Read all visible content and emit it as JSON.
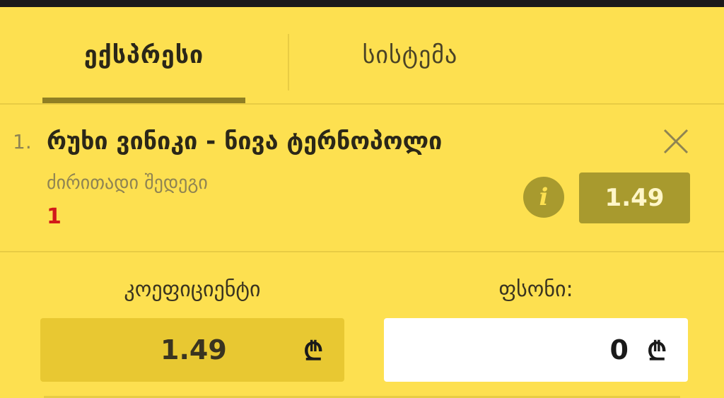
{
  "tabs": {
    "express": "ექსპრესი",
    "system": "სისტემა"
  },
  "selection": {
    "index": "1.",
    "title": "რუხი ვინიკი - ნივა ტერნოპოლი",
    "market": "ძირითადი შედეგი",
    "pick": "1",
    "odds": "1.49"
  },
  "coefficient": {
    "label": "კოეფიციენტი",
    "value": "1.49",
    "currency": "₾"
  },
  "stake": {
    "label": "ფსონი:",
    "value": "0",
    "currency": "₾"
  },
  "colors": {
    "background": "#fde050",
    "accent": "#a89a2e",
    "pick_red": "#d11a1a"
  },
  "icons": {
    "close": "close-icon",
    "info": "info-icon",
    "currency": "lari-icon"
  }
}
